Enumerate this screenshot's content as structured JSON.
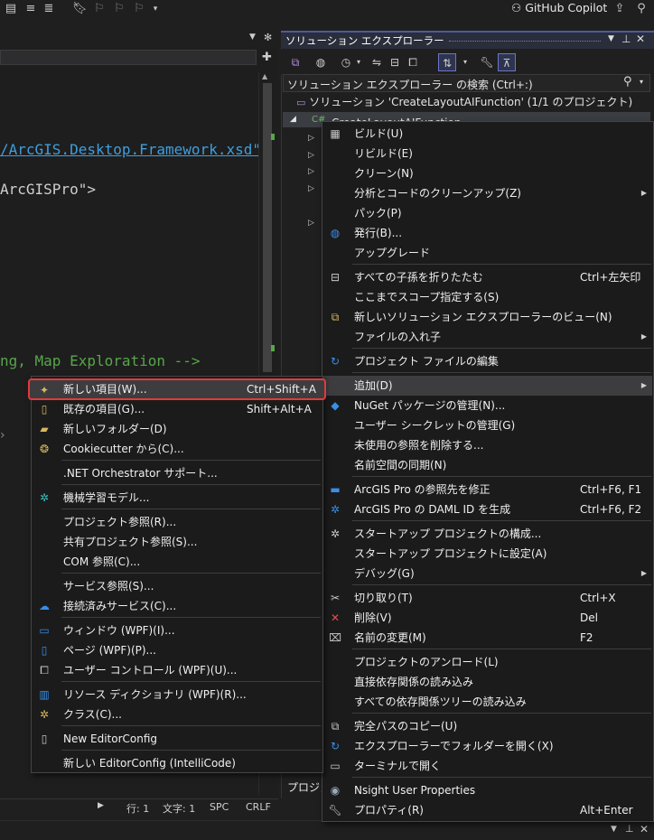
{
  "toolbar": {
    "copilot_label": "GitHub Copilot"
  },
  "editor": {
    "code_lines": [
      "/ArcGIS.Desktop.Framework.xsd\"",
      "ArcGISPro\">",
      "ng, Map Exploration -->"
    ],
    "status": {
      "line": "行: 1",
      "char": "文字: 1",
      "spc": "SPC",
      "crlf": "CRLF"
    }
  },
  "solution_explorer": {
    "title": "ソリューション エクスプローラー",
    "search_placeholder": "ソリューション エクスプローラー の検索 (Ctrl+:)",
    "solution_label": "ソリューション 'CreateLayoutAIFunction' (1/1 のプロジェクト)",
    "project_label": "CreateLayoutAIFunction",
    "lower_label": "プロジェ"
  },
  "context_menu": {
    "items": [
      {
        "label": "ビルド(U)",
        "icon": "build-icon"
      },
      {
        "label": "リビルド(E)"
      },
      {
        "label": "クリーン(N)"
      },
      {
        "label": "分析とコードのクリーンアップ(Z)",
        "submenu": true
      },
      {
        "label": "パック(P)"
      },
      {
        "label": "発行(B)...",
        "icon": "globe-icon"
      },
      {
        "label": "アップグレード"
      },
      {
        "label": "すべての子孫を折りたたむ",
        "shortcut": "Ctrl+左矢印",
        "icon": "collapse-icon"
      },
      {
        "label": "ここまでスコープ指定する(S)"
      },
      {
        "label": "新しいソリューション エクスプローラーのビュー(N)",
        "icon": "new-view-icon"
      },
      {
        "label": "ファイルの入れ子",
        "submenu": true
      },
      {
        "label": "プロジェクト ファイルの編集",
        "icon": "edit-project-icon"
      },
      {
        "label": "追加(D)",
        "submenu": true
      },
      {
        "label": "NuGet パッケージの管理(N)...",
        "icon": "nuget-icon"
      },
      {
        "label": "ユーザー シークレットの管理(G)"
      },
      {
        "label": "未使用の参照を削除する..."
      },
      {
        "label": "名前空間の同期(N)"
      },
      {
        "label": "ArcGIS Pro の参照先を修正",
        "shortcut": "Ctrl+F6, F1",
        "icon": "arcgis-fix-icon"
      },
      {
        "label": "ArcGIS Pro の DAML ID を生成",
        "shortcut": "Ctrl+F6, F2",
        "icon": "gear-blue-icon"
      },
      {
        "label": "スタートアップ プロジェクトの構成...",
        "icon": "gear-icon"
      },
      {
        "label": "スタートアップ プロジェクトに設定(A)"
      },
      {
        "label": "デバッグ(G)",
        "submenu": true
      },
      {
        "label": "切り取り(T)",
        "shortcut": "Ctrl+X",
        "icon": "cut-icon"
      },
      {
        "label": "削除(V)",
        "shortcut": "Del",
        "icon": "delete-icon"
      },
      {
        "label": "名前の変更(M)",
        "shortcut": "F2",
        "icon": "rename-icon"
      },
      {
        "label": "プロジェクトのアンロード(L)"
      },
      {
        "label": "直接依存関係の読み込み"
      },
      {
        "label": "すべての依存関係ツリーの読み込み"
      },
      {
        "label": "完全パスのコピー(U)",
        "icon": "copy-icon"
      },
      {
        "label": "エクスプローラーでフォルダーを開く(X)",
        "icon": "refresh-icon"
      },
      {
        "label": "ターミナルで開く",
        "icon": "terminal-icon"
      },
      {
        "label": "Nsight User Properties",
        "icon": "nsight-icon"
      },
      {
        "label": "プロパティ(R)",
        "shortcut": "Alt+Enter",
        "icon": "wrench-icon"
      }
    ]
  },
  "add_submenu": {
    "items": [
      {
        "label": "新しい項目(W)...",
        "shortcut": "Ctrl+Shift+A",
        "icon": "new-item-icon"
      },
      {
        "label": "既存の項目(G)...",
        "shortcut": "Shift+Alt+A",
        "icon": "existing-item-icon"
      },
      {
        "label": "新しいフォルダー(D)",
        "icon": "folder-icon"
      },
      {
        "label": "Cookiecutter から(C)...",
        "icon": "cookie-icon"
      },
      {
        "label": ".NET Orchestrator サポート..."
      },
      {
        "label": "機械学習モデル...",
        "icon": "ml-icon"
      },
      {
        "label": "プロジェクト参照(R)..."
      },
      {
        "label": "共有プロジェクト参照(S)..."
      },
      {
        "label": "COM 参照(C)..."
      },
      {
        "label": "サービス参照(S)..."
      },
      {
        "label": "接続済みサービス(C)...",
        "icon": "connected-service-icon"
      },
      {
        "label": "ウィンドウ (WPF)(I)...",
        "icon": "window-icon"
      },
      {
        "label": "ページ (WPF)(P)...",
        "icon": "page-icon"
      },
      {
        "label": "ユーザー コントロール (WPF)(U)...",
        "icon": "user-control-icon"
      },
      {
        "label": "リソース ディクショナリ (WPF)(R)...",
        "icon": "dictionary-icon"
      },
      {
        "label": "クラス(C)...",
        "icon": "class-icon"
      },
      {
        "label": "New EditorConfig",
        "icon": "file-icon"
      },
      {
        "label": "新しい EditorConfig (IntelliCode)"
      }
    ]
  },
  "colors": {
    "highlight_border": "#e23a3a",
    "accent": "#4e5a9c",
    "arcgis_blue": "#3a8ee6"
  }
}
